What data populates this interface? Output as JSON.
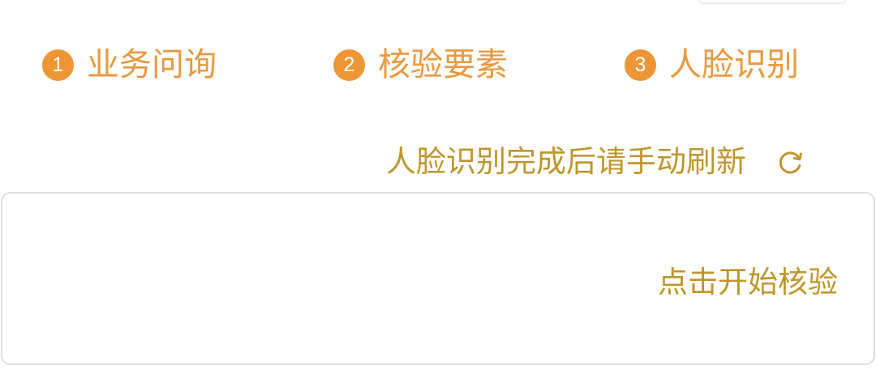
{
  "steps": [
    {
      "number": "1",
      "label": "业务问询"
    },
    {
      "number": "2",
      "label": "核验要素"
    },
    {
      "number": "3",
      "label": "人脸识别"
    }
  ],
  "refresh": {
    "text": "人脸识别完成后请手动刷新",
    "icon": "refresh-icon"
  },
  "card": {
    "start_label": "点击开始核验"
  },
  "colors": {
    "step_accent": "#ee9636",
    "step_text": "#e99a3f",
    "gold_text": "#c0962d",
    "card_border": "#dedede"
  }
}
